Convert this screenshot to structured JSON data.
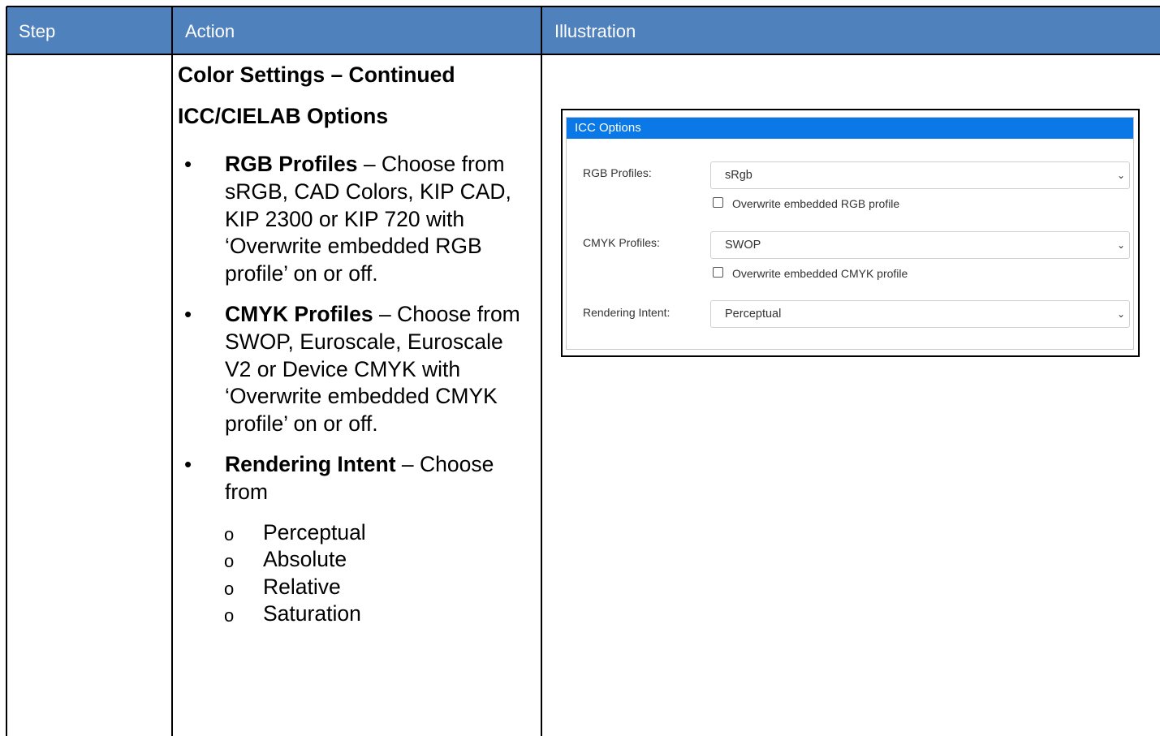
{
  "table": {
    "headers": [
      "Step",
      "Action",
      "Illustration"
    ]
  },
  "action": {
    "title": "Color Settings – Continued",
    "subtitle": "ICC/CIELAB Options",
    "bullets": [
      {
        "term": "RGB Profiles",
        "text": " – Choose from sRGB, CAD Colors, KIP CAD, KIP 2300 or KIP 720 with ‘Overwrite embedded RGB profile’ on or off."
      },
      {
        "term": "CMYK Profiles",
        "text": " – Choose from SWOP, Euroscale, Euroscale V2 or Device CMYK with ‘Overwrite embedded CMYK profile’ on or off."
      },
      {
        "term": "Rendering Intent",
        "text": " – Choose from"
      }
    ],
    "bullet_glyph": "•",
    "sub_glyph": "o",
    "intent_options": [
      "Perceptual",
      "Absolute",
      "Relative",
      "Saturation"
    ]
  },
  "illustration": {
    "panel_title": "ICC Options",
    "rgb_label": "RGB Profiles:",
    "rgb_value": "sRgb",
    "rgb_overwrite": "Overwrite embedded RGB profile",
    "cmyk_label": "CMYK Profiles:",
    "cmyk_value": "SWOP",
    "cmyk_overwrite": "Overwrite embedded CMYK profile",
    "intent_label": "Rendering Intent:",
    "intent_value": "Perceptual",
    "chevron": "⌄"
  },
  "colors": {
    "header_bg": "#4f81bd",
    "panel_header_bg": "#0a78e6"
  }
}
